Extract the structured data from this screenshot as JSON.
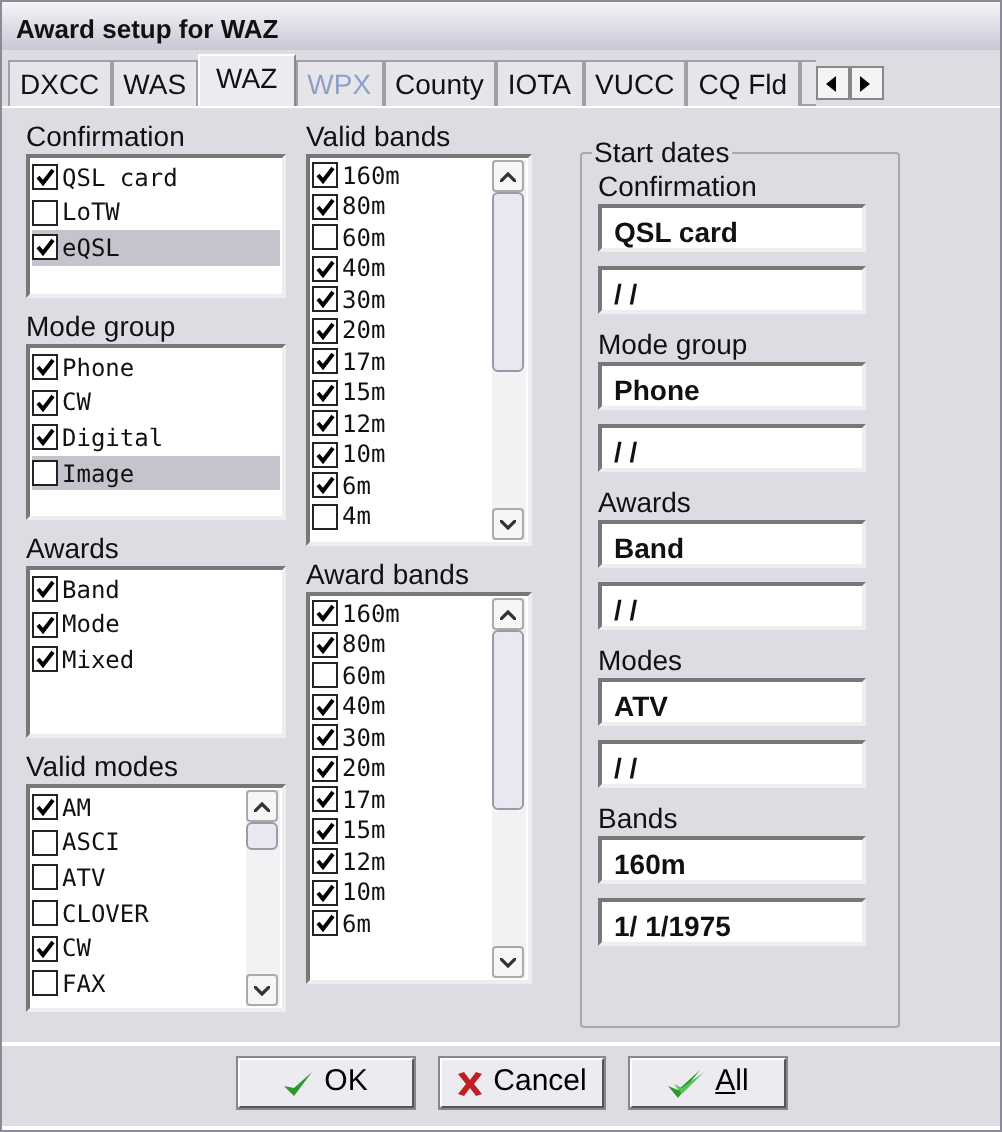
{
  "window": {
    "title": "Award setup for WAZ"
  },
  "tabs": [
    {
      "label": "DXCC",
      "selected": false,
      "disabled": false
    },
    {
      "label": "WAS",
      "selected": false,
      "disabled": false
    },
    {
      "label": "WAZ",
      "selected": true,
      "disabled": false
    },
    {
      "label": "WPX",
      "selected": false,
      "disabled": true
    },
    {
      "label": "County",
      "selected": false,
      "disabled": false
    },
    {
      "label": "IOTA",
      "selected": false,
      "disabled": false
    },
    {
      "label": "VUCC",
      "selected": false,
      "disabled": false
    },
    {
      "label": "CQ Fld",
      "selected": false,
      "disabled": false
    }
  ],
  "left_column": [
    {
      "title": "Confirmation",
      "scrollbar": false,
      "items": [
        {
          "label": "QSL card",
          "checked": true,
          "selected": false
        },
        {
          "label": "LoTW",
          "checked": false,
          "selected": false
        },
        {
          "label": "eQSL",
          "checked": true,
          "selected": true
        }
      ]
    },
    {
      "title": "Mode group",
      "scrollbar": false,
      "items": [
        {
          "label": "Phone",
          "checked": true,
          "selected": false
        },
        {
          "label": "CW",
          "checked": true,
          "selected": false
        },
        {
          "label": "Digital",
          "checked": true,
          "selected": false
        },
        {
          "label": "Image",
          "checked": false,
          "selected": true
        }
      ]
    },
    {
      "title": "Awards",
      "scrollbar": false,
      "items": [
        {
          "label": "Band",
          "checked": true,
          "selected": false
        },
        {
          "label": "Mode",
          "checked": true,
          "selected": false
        },
        {
          "label": "Mixed",
          "checked": true,
          "selected": false
        }
      ]
    },
    {
      "title": "Valid modes",
      "scrollbar": true,
      "items": [
        {
          "label": "AM",
          "checked": true,
          "selected": false
        },
        {
          "label": "ASCI",
          "checked": false,
          "selected": false
        },
        {
          "label": "ATV",
          "checked": false,
          "selected": false
        },
        {
          "label": "CLOVER",
          "checked": false,
          "selected": false
        },
        {
          "label": "CW",
          "checked": true,
          "selected": false
        },
        {
          "label": "FAX",
          "checked": false,
          "selected": false
        }
      ]
    }
  ],
  "middle_column": [
    {
      "title": "Valid bands",
      "scrollbar": true,
      "items": [
        {
          "label": "160m",
          "checked": true,
          "selected": false
        },
        {
          "label": "80m",
          "checked": true,
          "selected": false
        },
        {
          "label": "60m",
          "checked": false,
          "selected": false
        },
        {
          "label": "40m",
          "checked": true,
          "selected": false
        },
        {
          "label": "30m",
          "checked": true,
          "selected": false
        },
        {
          "label": "20m",
          "checked": true,
          "selected": false
        },
        {
          "label": "17m",
          "checked": true,
          "selected": false
        },
        {
          "label": "15m",
          "checked": true,
          "selected": false
        },
        {
          "label": "12m",
          "checked": true,
          "selected": false
        },
        {
          "label": "10m",
          "checked": true,
          "selected": false
        },
        {
          "label": "6m",
          "checked": true,
          "selected": false
        },
        {
          "label": "4m",
          "checked": false,
          "selected": false
        }
      ]
    },
    {
      "title": "Award bands",
      "scrollbar": true,
      "items": [
        {
          "label": "160m",
          "checked": true,
          "selected": false
        },
        {
          "label": "80m",
          "checked": true,
          "selected": false
        },
        {
          "label": "60m",
          "checked": false,
          "selected": false
        },
        {
          "label": "40m",
          "checked": true,
          "selected": false
        },
        {
          "label": "30m",
          "checked": true,
          "selected": false
        },
        {
          "label": "20m",
          "checked": true,
          "selected": false
        },
        {
          "label": "17m",
          "checked": true,
          "selected": false
        },
        {
          "label": "15m",
          "checked": true,
          "selected": false
        },
        {
          "label": "12m",
          "checked": true,
          "selected": false
        },
        {
          "label": "10m",
          "checked": true,
          "selected": false
        },
        {
          "label": "6m",
          "checked": true,
          "selected": false
        }
      ]
    }
  ],
  "start_dates": {
    "title": "Start dates",
    "groups": [
      {
        "label": "Confirmation",
        "value": "QSL card",
        "date": "/ /"
      },
      {
        "label": "Mode group",
        "value": "Phone",
        "date": "/ /"
      },
      {
        "label": "Awards",
        "value": "Band",
        "date": "/ /"
      },
      {
        "label": "Modes",
        "value": "ATV",
        "date": "/ /"
      },
      {
        "label": "Bands",
        "value": "160m",
        "date": "1/ 1/1975"
      }
    ]
  },
  "buttons": [
    {
      "label": "OK",
      "kind": "ok"
    },
    {
      "label": "Cancel",
      "kind": "cancel"
    },
    {
      "label": "All",
      "kind": "all"
    }
  ]
}
